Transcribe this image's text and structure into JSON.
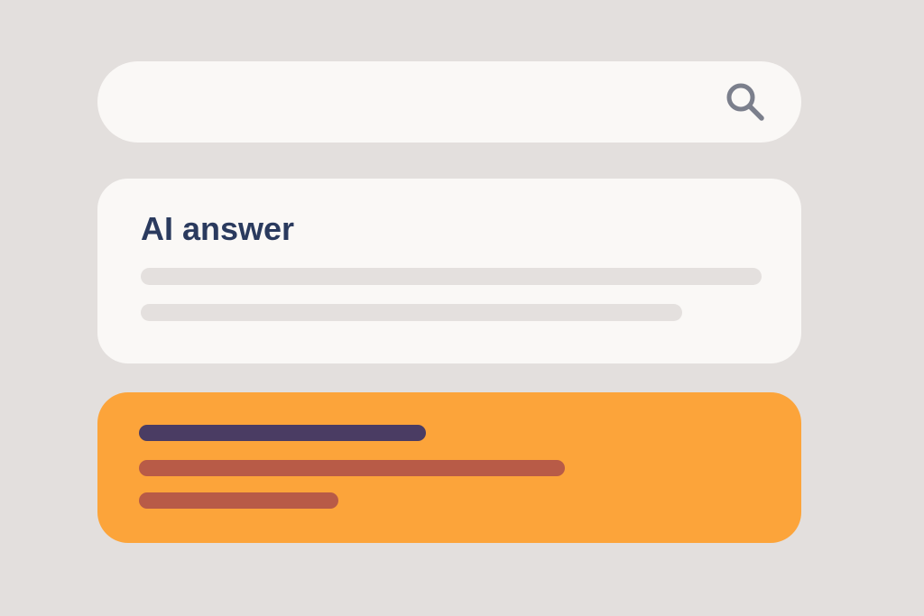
{
  "search": {
    "value": "",
    "placeholder": "",
    "icon": "search-icon"
  },
  "ai_answer": {
    "title": "AI answer"
  },
  "result": {
    "link_lines": 1,
    "snippet_lines": 2
  },
  "colors": {
    "background": "#e3dfdd",
    "card": "#faf8f6",
    "title": "#2a3a5e",
    "skeleton": "#e4e0de",
    "search_icon": "#7b7f8c",
    "highlight_card": "#fca43a",
    "highlight_title_bar": "#4a3c63",
    "highlight_text_bar": "#b85b47"
  }
}
